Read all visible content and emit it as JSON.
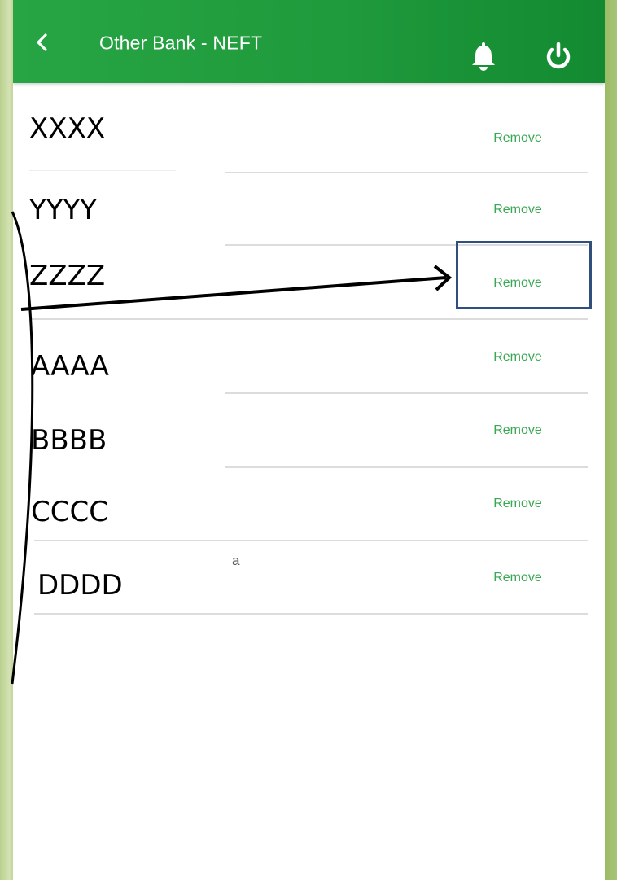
{
  "header": {
    "title": "Other Bank - NEFT",
    "back_icon": "chevron-left-icon",
    "bell_icon": "bell-icon",
    "power_icon": "power-icon"
  },
  "beneficiaries": [
    {
      "name": "XXXX",
      "action": "Remove"
    },
    {
      "name": "YYYY",
      "action": "Remove"
    },
    {
      "name": "ZZZZ",
      "action": "Remove"
    },
    {
      "name": "AAAA",
      "action": "Remove"
    },
    {
      "name": "BBBB",
      "action": "Remove"
    },
    {
      "name": "CCCC",
      "action": "Remove"
    },
    {
      "name": "DDDD",
      "action": "Remove"
    }
  ],
  "stray_text": "a",
  "colors": {
    "header": "#1f9a3c",
    "remove_text": "#39a853",
    "annotation_box": "#2f4f7c",
    "background": "#9fbf6a"
  }
}
